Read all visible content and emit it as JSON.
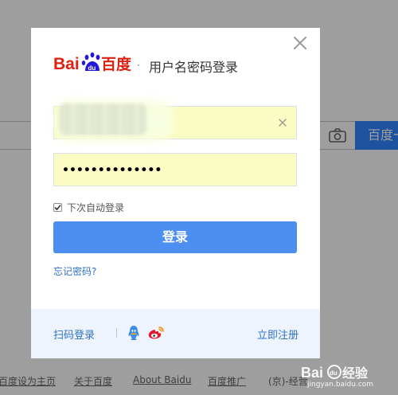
{
  "background": {
    "search_button_label": "百度一下",
    "footer_links": [
      "百度设为主页",
      "关于百度",
      "About Baidu",
      "百度推广",
      "(京)-经营"
    ]
  },
  "modal": {
    "logo_text": "Bai百度",
    "title": "用户名密码登录",
    "username_value": "",
    "password_mask": "••••••••••••••",
    "remember_label": "下次自动登录",
    "remember_checked": true,
    "login_button": "登录",
    "forgot_link": "忘记密码?",
    "qr_login": "扫码登录",
    "register_link": "立即注册"
  },
  "icons": [
    "close-icon",
    "clear-icon",
    "qq-icon",
    "weibo-icon",
    "camera-icon"
  ],
  "colors": {
    "accent": "#4c8ff1",
    "link": "#2f72c4",
    "autofill": "#fafcc4",
    "footer_bg": "#eef4fd",
    "baidu_red": "#de2110",
    "baidu_blue": "#2319dc"
  },
  "watermark": {
    "site": "jingyan.baidu.com"
  }
}
